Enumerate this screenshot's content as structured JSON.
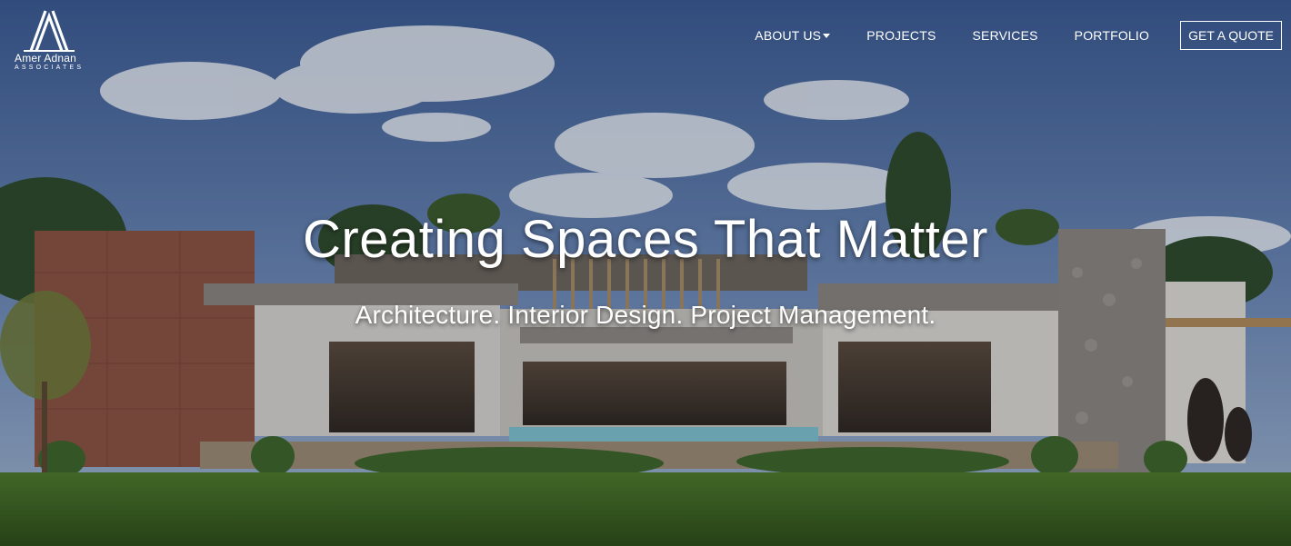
{
  "brand": {
    "name": "Amer Adnan",
    "subtitle": "ASSOCIATES",
    "logo_icon": "tent-peaks-logo"
  },
  "nav": {
    "items": [
      {
        "label": "ABOUT US",
        "dropdown": true
      },
      {
        "label": "PROJECTS",
        "dropdown": false
      },
      {
        "label": "SERVICES",
        "dropdown": false
      },
      {
        "label": "PORTFOLIO",
        "dropdown": false
      }
    ],
    "cta_label": "GET A QUOTE"
  },
  "hero": {
    "headline": "Creating Spaces That Matter",
    "tagline": "Architecture. Interior Design. Project Management.",
    "background": "modern-house-photo"
  },
  "colors": {
    "sky_top": "#3f5f97",
    "sky_bottom": "#8fa8c8",
    "lawn": "#3f6a22",
    "text": "#ffffff"
  }
}
